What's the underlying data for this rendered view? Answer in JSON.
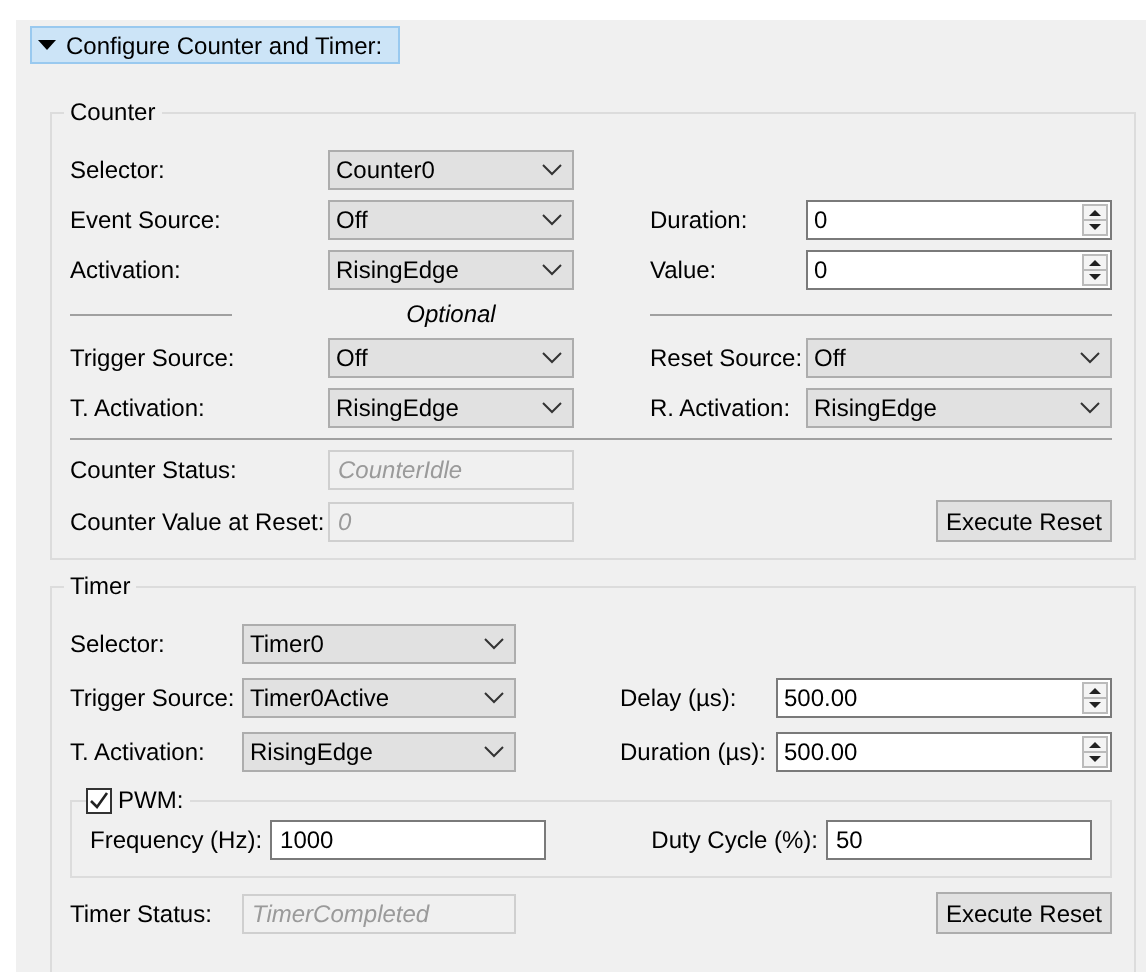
{
  "header": {
    "title": "Configure Counter and Timer:",
    "expanded": true
  },
  "groups": [
    {
      "kind": "counter",
      "title": "Counter",
      "rows": [
        {
          "kind": "fields",
          "left": {
            "label": "Selector:",
            "control": {
              "kind": "combo",
              "value": "Counter0"
            }
          }
        },
        {
          "kind": "fields",
          "left": {
            "label": "Event Source:",
            "control": {
              "kind": "combo",
              "value": "Off"
            }
          },
          "right": {
            "label": "Duration:",
            "control": {
              "kind": "spin",
              "value": "0"
            }
          }
        },
        {
          "kind": "fields",
          "left": {
            "label": "Activation:",
            "control": {
              "kind": "combo",
              "value": "RisingEdge"
            }
          },
          "right": {
            "label": "Value:",
            "control": {
              "kind": "spin",
              "value": "0"
            }
          }
        },
        {
          "kind": "divider",
          "text": "Optional"
        },
        {
          "kind": "fields",
          "left": {
            "label": "Trigger Source:",
            "control": {
              "kind": "combo",
              "value": "Off"
            }
          },
          "right": {
            "label": "Reset Source:",
            "control": {
              "kind": "combo",
              "value": "Off"
            }
          }
        },
        {
          "kind": "fields",
          "left": {
            "label": "T. Activation:",
            "control": {
              "kind": "combo",
              "value": "RisingEdge"
            }
          },
          "right": {
            "label": "R. Activation:",
            "control": {
              "kind": "combo",
              "value": "RisingEdge"
            }
          }
        },
        {
          "kind": "divider"
        },
        {
          "kind": "fields",
          "left": {
            "label": "Counter Status:",
            "control": {
              "kind": "readonly",
              "value": "CounterIdle",
              "disabled": true
            }
          }
        },
        {
          "kind": "fields",
          "left": {
            "label": "Counter Value at Reset:",
            "control": {
              "kind": "readonly",
              "value": "0",
              "disabled": true
            }
          },
          "right": {
            "control": {
              "kind": "button",
              "value": "Execute Reset"
            }
          }
        }
      ]
    },
    {
      "kind": "timer",
      "title": "Timer",
      "rows": [
        {
          "kind": "fields",
          "left": {
            "label": "Selector:",
            "control": {
              "kind": "combo",
              "value": "Timer0"
            }
          }
        },
        {
          "kind": "fields",
          "left": {
            "label": "Trigger Source:",
            "control": {
              "kind": "combo",
              "value": "Timer0Active"
            }
          },
          "right": {
            "label": "Delay (µs):",
            "control": {
              "kind": "spin",
              "value": "500.00"
            }
          }
        },
        {
          "kind": "fields",
          "left": {
            "label": "T. Activation:",
            "control": {
              "kind": "combo",
              "value": "RisingEdge"
            }
          },
          "right": {
            "label": "Duration (µs):",
            "control": {
              "kind": "spin",
              "value": "500.00"
            }
          }
        },
        {
          "kind": "subgroup",
          "title": "PWM:",
          "checked": true,
          "left": {
            "label": "Frequency (Hz):",
            "control": {
              "kind": "text",
              "value": "1000"
            }
          },
          "right": {
            "label": "Duty Cycle (%):",
            "control": {
              "kind": "text",
              "value": "50"
            }
          }
        },
        {
          "kind": "fields",
          "left": {
            "label": "Timer Status:",
            "control": {
              "kind": "readonly",
              "value": "TimerCompleted",
              "disabled": true
            }
          },
          "right": {
            "control": {
              "kind": "button",
              "value": "Execute Reset"
            }
          }
        }
      ]
    }
  ]
}
